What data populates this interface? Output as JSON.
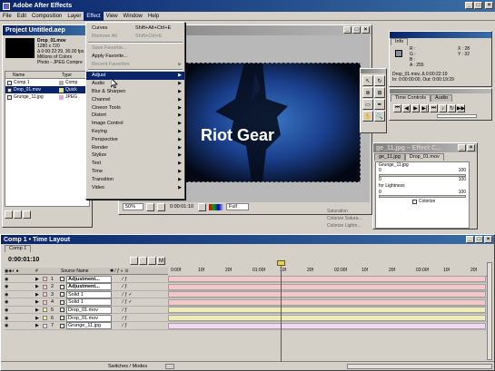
{
  "app": {
    "title": "Adobe After Effects"
  },
  "menubar": [
    "File",
    "Edit",
    "Composition",
    "Layer",
    "Effect",
    "View",
    "Window",
    "Help"
  ],
  "effect_menu": {
    "items": [
      {
        "label": "Curves",
        "shortcut": "Shift+Alt+Ctrl+E",
        "disabled": false
      },
      {
        "label": "Remove All",
        "shortcut": "Shift+Ctrl+E",
        "disabled": true
      },
      {
        "sep": true
      },
      {
        "label": "Save Favorite...",
        "disabled": true
      },
      {
        "label": "Apply Favorite...",
        "disabled": false
      },
      {
        "label": "Recent Favorites",
        "arrow": true,
        "disabled": true
      },
      {
        "sep": true
      },
      {
        "label": "Adjust",
        "arrow": true,
        "highlight": true
      },
      {
        "label": "Audio",
        "arrow": true
      },
      {
        "label": "Blur & Sharpen",
        "arrow": true
      },
      {
        "label": "Channel",
        "arrow": true
      },
      {
        "label": "Cineon Tools",
        "arrow": true
      },
      {
        "label": "Distort",
        "arrow": true
      },
      {
        "label": "Image Control",
        "arrow": true
      },
      {
        "label": "Keying",
        "arrow": true
      },
      {
        "label": "Perspective",
        "arrow": true
      },
      {
        "label": "Render",
        "arrow": true
      },
      {
        "label": "Stylize",
        "arrow": true
      },
      {
        "label": "Text",
        "arrow": true
      },
      {
        "label": "Time",
        "arrow": true
      },
      {
        "label": "Transition",
        "arrow": true
      },
      {
        "label": "Video",
        "arrow": true
      }
    ]
  },
  "project": {
    "title": "Project Untitled.aep",
    "footage_name": "Drop_01.mov",
    "footage_info": [
      "1280 x 720",
      "Δ 0:00:22:29, 30.00 fps",
      "Millions of Colors",
      "Photo - JPEG Compre"
    ],
    "columns": [
      "Name",
      "Type"
    ],
    "items": [
      {
        "name": "Comp 1",
        "type": "Comp",
        "color": "#b4b0a0"
      },
      {
        "name": "Drop_01.mov",
        "type": "Quick",
        "color": "#e8e060",
        "selected": true
      },
      {
        "name": "Grunge_11.jpg",
        "type": "JPEG",
        "color": "#e0a8d8"
      }
    ]
  },
  "comp_window": {
    "overlay_text": "Riot Gear",
    "zoom": "50%",
    "timecode": "0:00:01:10",
    "resolution": "Full"
  },
  "info_panel": {
    "title": "Info",
    "r_label": "R :",
    "g_label": "G :",
    "b_label": "B :",
    "a_label": "A : 255",
    "x_label": "X : 28",
    "y_label": "Y : 32",
    "line1": "Drop_01.mov, Δ 0:00:22:19",
    "line2": "In: 0:00:00:00, Out: 0:00:19:29"
  },
  "time_controls": {
    "tabs": [
      "Time Controls",
      "Audio"
    ]
  },
  "effect_controls": {
    "title": "ge_11.jpg – Effect C...",
    "tabs": [
      "ge_11.jpg",
      "Drop_01.mov"
    ],
    "layer": "Grunge_11.jpg",
    "val1": "100",
    "val2": "100",
    "val3": "100",
    "label_lightness": "for Lightness",
    "lightness_val": "0",
    "colorize_label": "Colorize",
    "footer1": "Saturation",
    "footer2": "Colorize Satura...",
    "footer3": "Colorize Lightn..."
  },
  "timeline": {
    "title": "Comp 1 • Time Layout",
    "tab": "Comp 1",
    "timecode": "0:00:01:10",
    "ruler": [
      "0:00f",
      "10f",
      "20f",
      "01:00f",
      "10f",
      "20f",
      "02:00f",
      "10f",
      "20f",
      "03:00f",
      "10f",
      "20f"
    ],
    "col_header": "Source Name",
    "switches_label": "Switches / Modes",
    "layers": [
      {
        "num": "1",
        "name": "Adjustment...",
        "color": "#f4c8c8",
        "bold": true,
        "chk": false
      },
      {
        "num": "2",
        "name": "Adjustment...",
        "color": "#f4c8c8",
        "bold": true,
        "chk": false
      },
      {
        "num": "3",
        "name": "Solid 1",
        "color": "#f4c8c8",
        "bold": false,
        "chk": true
      },
      {
        "num": "4",
        "name": "Solid 1",
        "color": "#f4c8c8",
        "bold": false,
        "chk": true
      },
      {
        "num": "5",
        "name": "Drop_01.mov",
        "color": "#f0ecb8",
        "bold": false,
        "chk": false
      },
      {
        "num": "6",
        "name": "Drop_01.mov",
        "color": "#f0ecb8",
        "bold": false,
        "chk": false
      },
      {
        "num": "7",
        "name": "Grunge_11.jpg",
        "color": "#f0d8ee",
        "bold": false,
        "chk": false
      }
    ]
  },
  "colors": {
    "titlebar": "#0a246a",
    "panel": "#d4d0c8",
    "playhead": "#e02020"
  }
}
